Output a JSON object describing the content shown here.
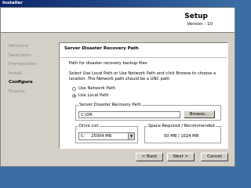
{
  "window": {
    "title": "Installer"
  },
  "header": {
    "title": "Setup",
    "version": "Version : 10"
  },
  "steps": [
    {
      "label": "Welcome",
      "current": false
    },
    {
      "label": "Selections",
      "current": false
    },
    {
      "label": "Prerequisites",
      "current": false
    },
    {
      "label": "Install",
      "current": false
    },
    {
      "label": "Configure",
      "current": true
    },
    {
      "label": "Finalize",
      "current": false
    }
  ],
  "panel": {
    "title": "Server Disaster Recovery Path",
    "subtitle": "Path for disaster recovery backup files",
    "instructions": "Select Use Local Path or Use Network Path and click Browse to choose a location. The Network path should be a UNC path",
    "radio_network": "Use Network Path",
    "radio_local": "Use Local Path",
    "radio_selected": "local",
    "path_group_label": "Server Disaster Recovery Path",
    "path_value": "C:\\DR",
    "browse_label": "Browse...",
    "drive_group_label": "Drive List",
    "drive_letter": "C:",
    "drive_size": "25004 MB",
    "space_group_label": "Space Required / Recommended",
    "space_value": "50 MB / 1024 MB"
  },
  "footer": {
    "back_label": "< Back",
    "next_label": "Next >",
    "cancel_label": "Cancel"
  }
}
